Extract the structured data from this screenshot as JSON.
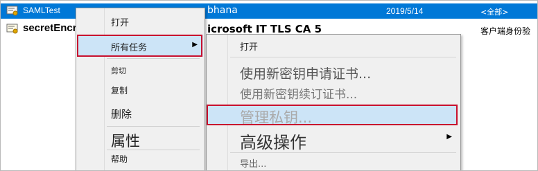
{
  "list": {
    "rows": [
      {
        "name": "SAMLTest",
        "issuer": "bhana",
        "date": "2019/5/14",
        "purpose": "<全部>"
      },
      {
        "name": "secretEncry",
        "issuer": "icrosoft IT TLS CA 5",
        "date": "",
        "purpose": "客户端身份验"
      }
    ]
  },
  "menu1": {
    "open": "打开",
    "all_tasks": "所有任务",
    "cut": "剪切",
    "copy": "复制",
    "delete": "删除",
    "properties": "属性",
    "help": "帮助"
  },
  "menu2": {
    "open": "打开",
    "request_new_key": "使用新密钥申请证书...",
    "renew_new_key": "使用新密钥续订证书...",
    "manage_private_keys": "管理私钥...",
    "advanced_operations": "高级操作",
    "export": "导出..."
  },
  "colors": {
    "selection": "#0078d7",
    "menu_highlight": "#cce4f7",
    "annotation_red": "#c8102e"
  },
  "icons": {
    "submenu_arrow": "▶",
    "certificate": "certificate-icon"
  }
}
